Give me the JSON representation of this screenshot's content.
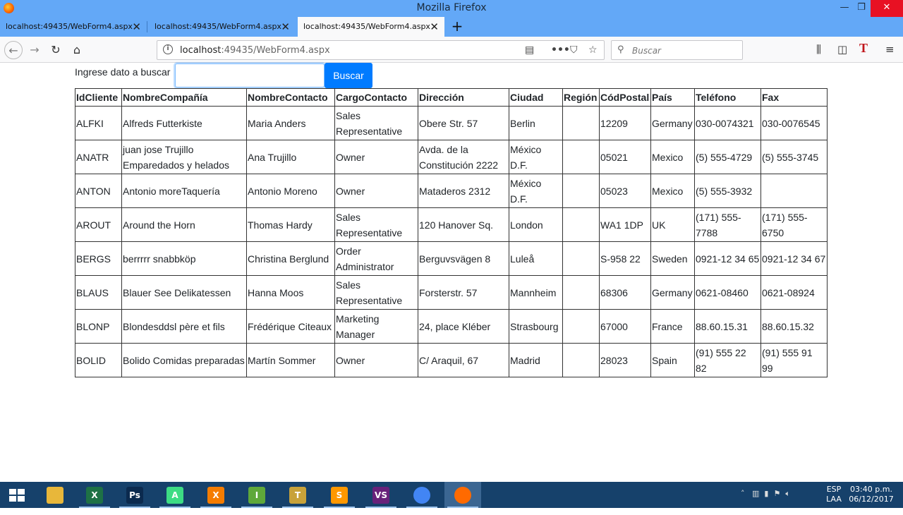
{
  "window": {
    "title": "Mozilla Firefox",
    "controls": [
      "—",
      "❐",
      "✕"
    ]
  },
  "tabs": [
    {
      "label": "localhost:49435/WebForm4.aspx",
      "active": false
    },
    {
      "label": "localhost:49435/WebForm4.aspx",
      "active": false
    },
    {
      "label": "localhost:49435/WebForm4.aspx",
      "active": true
    }
  ],
  "navbar": {
    "url_host": "localhost",
    "url_rest": ":49435/WebForm4.aspx",
    "search_placeholder": "Buscar"
  },
  "form": {
    "label": "Ingrese dato a buscar",
    "input_value": "",
    "button_label": "Buscar"
  },
  "table": {
    "headers": [
      "IdCliente",
      "NombreCompañía",
      "NombreContacto",
      "CargoContacto",
      "Dirección",
      "Ciudad",
      "Región",
      "CódPostal",
      "País",
      "Teléfono",
      "Fax"
    ],
    "rows": [
      [
        "ALFKI",
        "Alfreds Futterkiste",
        "Maria Anders",
        "Sales Representative",
        "Obere Str. 57",
        "Berlin",
        "",
        "12209",
        "Germany",
        "030-0074321",
        "030-0076545"
      ],
      [
        "ANATR",
        "juan jose Trujillo Emparedados y helados",
        "Ana Trujillo",
        "Owner",
        "Avda. de la Constitución 2222",
        "México D.F.",
        "",
        "05021",
        "Mexico",
        "(5) 555-4729",
        "(5) 555-3745"
      ],
      [
        "ANTON",
        "Antonio moreTaquería",
        "Antonio Moreno",
        "Owner",
        "Mataderos 2312",
        "México D.F.",
        "",
        "05023",
        "Mexico",
        "(5) 555-3932",
        ""
      ],
      [
        "AROUT",
        "Around the Horn",
        "Thomas Hardy",
        "Sales Representative",
        "120 Hanover Sq.",
        "London",
        "",
        "WA1 1DP",
        "UK",
        "(171) 555-7788",
        "(171) 555-6750"
      ],
      [
        "BERGS",
        "berrrrr snabbköp",
        "Christina Berglund",
        "Order Administrator",
        "Berguvsvägen 8",
        "Luleå",
        "",
        "S-958 22",
        "Sweden",
        "0921-12 34 65",
        "0921-12 34 67"
      ],
      [
        "BLAUS",
        "Blauer See Delikatessen",
        "Hanna Moos",
        "Sales Representative",
        "Forsterstr. 57",
        "Mannheim",
        "",
        "68306",
        "Germany",
        "0621-08460",
        "0621-08924"
      ],
      [
        "BLONP",
        "Blondesddsl père et fils",
        "Frédérique Citeaux",
        "Marketing Manager",
        "24, place Kléber",
        "Strasbourg",
        "",
        "67000",
        "France",
        "88.60.15.31",
        "88.60.15.32"
      ],
      [
        "BOLID",
        "Bolido Comidas preparadas",
        "Martín Sommer",
        "Owner",
        "C/ Araquil, 67",
        "Madrid",
        "",
        "28023",
        "Spain",
        "(91) 555 22 82",
        "(91) 555 91 99"
      ]
    ]
  },
  "taskbar": {
    "apps": [
      {
        "name": "file-explorer",
        "glyph": "",
        "color": "#e8b73a"
      },
      {
        "name": "excel",
        "glyph": "X",
        "color": "#1e7145"
      },
      {
        "name": "photoshop",
        "glyph": "Ps",
        "color": "#0b2a4e"
      },
      {
        "name": "android-studio",
        "glyph": "A",
        "color": "#3ddc84"
      },
      {
        "name": "xampp",
        "glyph": "X",
        "color": "#f57c00"
      },
      {
        "name": "inkscape",
        "glyph": "I",
        "color": "#5fa83a"
      },
      {
        "name": "tools",
        "glyph": "T",
        "color": "#c8a23a"
      },
      {
        "name": "sublime-text",
        "glyph": "S",
        "color": "#ff9800"
      },
      {
        "name": "visual-studio",
        "glyph": "VS",
        "color": "#68217a"
      },
      {
        "name": "chrome",
        "glyph": "",
        "color": "#4285f4"
      },
      {
        "name": "firefox",
        "glyph": "",
        "color": "#ff6a00"
      }
    ],
    "lang_top": "ESP",
    "lang_bottom": "LAA",
    "time": "03:40 p.m.",
    "date": "06/12/2017"
  }
}
